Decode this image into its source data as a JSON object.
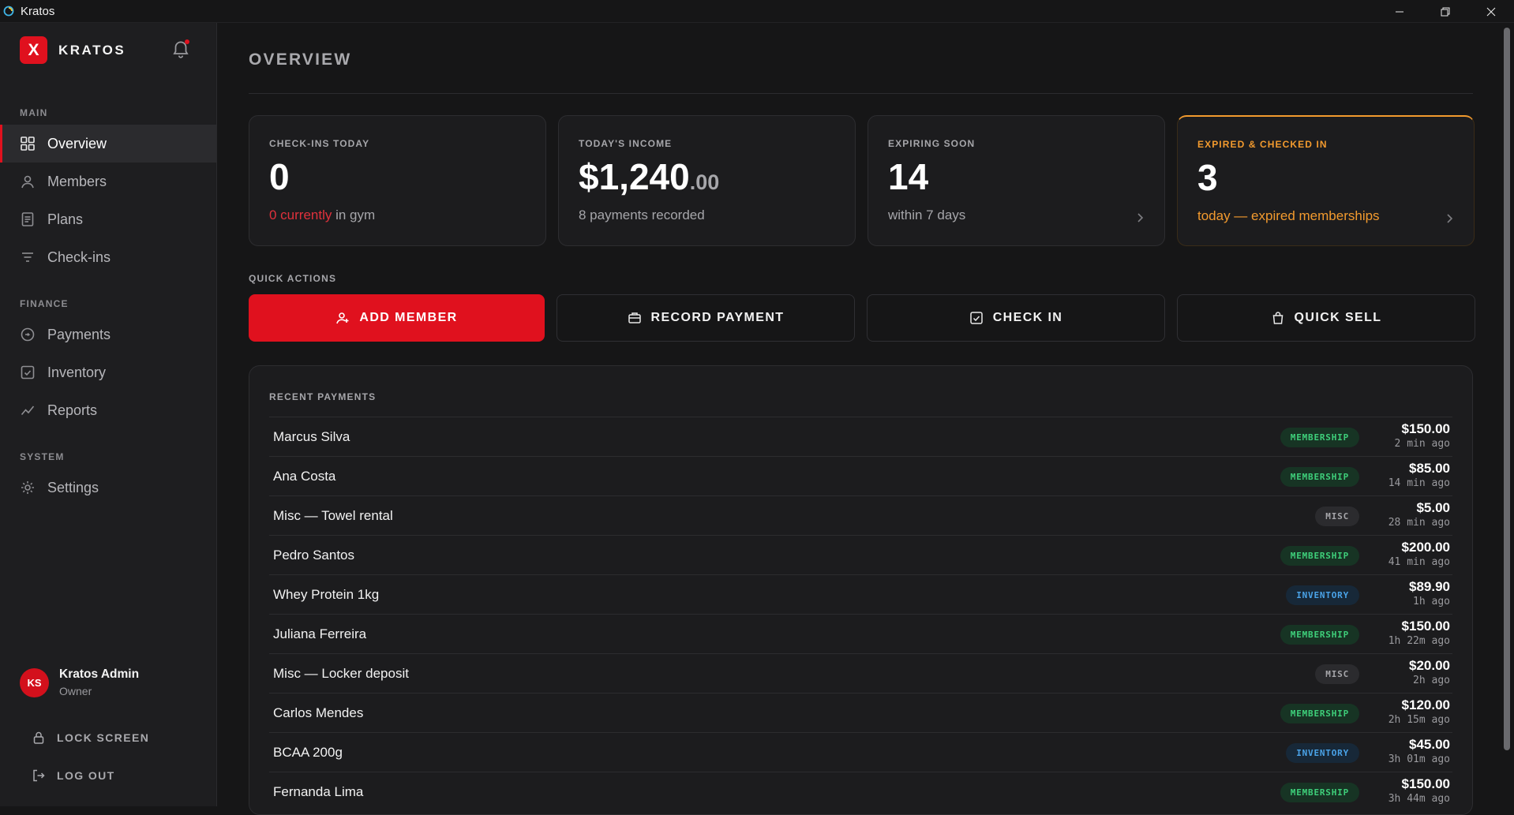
{
  "window": {
    "title": "Kratos"
  },
  "brand": {
    "logo_letter": "X",
    "name": "KRATOS"
  },
  "sidebar": {
    "sections": [
      {
        "label": "MAIN"
      },
      {
        "label": "FINANCE"
      },
      {
        "label": "SYSTEM"
      }
    ],
    "items": [
      {
        "label": "Overview",
        "icon": "grid-icon",
        "active": true
      },
      {
        "label": "Members",
        "icon": "user-icon"
      },
      {
        "label": "Plans",
        "icon": "document-icon"
      },
      {
        "label": "Check-ins",
        "icon": "filter-icon"
      },
      {
        "label": "Payments",
        "icon": "coin-icon"
      },
      {
        "label": "Inventory",
        "icon": "checkbox-icon"
      },
      {
        "label": "Reports",
        "icon": "trend-icon"
      },
      {
        "label": "Settings",
        "icon": "sun-gear-icon"
      }
    ],
    "user": {
      "initials": "KS",
      "name": "Kratos Admin",
      "role": "Owner"
    },
    "lock_label": "LOCK SCREEN",
    "logout_label": "LOG OUT"
  },
  "main": {
    "title": "OVERVIEW",
    "stats": [
      {
        "label": "CHECK-INS TODAY",
        "value": "0",
        "sub_highlight": "0 currently",
        "sub_rest": " in gym"
      },
      {
        "label": "TODAY'S INCOME",
        "value": "$1,240",
        "cents": ".00",
        "sub": "8 payments recorded"
      },
      {
        "label": "EXPIRING SOON",
        "value": "14",
        "sub": "within 7 days"
      },
      {
        "label": "EXPIRED & CHECKED IN",
        "value": "3",
        "sub": "today — expired memberships"
      }
    ],
    "quick_actions_label": "QUICK ACTIONS",
    "quick_actions": [
      {
        "label": "ADD MEMBER"
      },
      {
        "label": "RECORD PAYMENT"
      },
      {
        "label": "CHECK IN"
      },
      {
        "label": "QUICK SELL"
      }
    ],
    "recent_payments_label": "RECENT PAYMENTS",
    "payments": [
      {
        "name": "Marcus Silva",
        "type": "MEMBERSHIP",
        "amount": "$150.00",
        "time": "2 min ago"
      },
      {
        "name": "Ana Costa",
        "type": "MEMBERSHIP",
        "amount": "$85.00",
        "time": "14 min ago"
      },
      {
        "name": "Misc — Towel rental",
        "type": "MISC",
        "amount": "$5.00",
        "time": "28 min ago"
      },
      {
        "name": "Pedro Santos",
        "type": "MEMBERSHIP",
        "amount": "$200.00",
        "time": "41 min ago"
      },
      {
        "name": "Whey Protein 1kg",
        "type": "INVENTORY",
        "amount": "$89.90",
        "time": "1h ago"
      },
      {
        "name": "Juliana Ferreira",
        "type": "MEMBERSHIP",
        "amount": "$150.00",
        "time": "1h 22m ago"
      },
      {
        "name": "Misc — Locker deposit",
        "type": "MISC",
        "amount": "$20.00",
        "time": "2h ago"
      },
      {
        "name": "Carlos Mendes",
        "type": "MEMBERSHIP",
        "amount": "$120.00",
        "time": "2h 15m ago"
      },
      {
        "name": "BCAA 200g",
        "type": "INVENTORY",
        "amount": "$45.00",
        "time": "3h 01m ago"
      },
      {
        "name": "Fernanda Lima",
        "type": "MEMBERSHIP",
        "amount": "$150.00",
        "time": "3h 44m ago"
      }
    ]
  },
  "colors": {
    "accent": "#e0111e",
    "warning": "#f29a2e",
    "membership": "#3ecf7a",
    "inventory": "#4aa3e8"
  }
}
